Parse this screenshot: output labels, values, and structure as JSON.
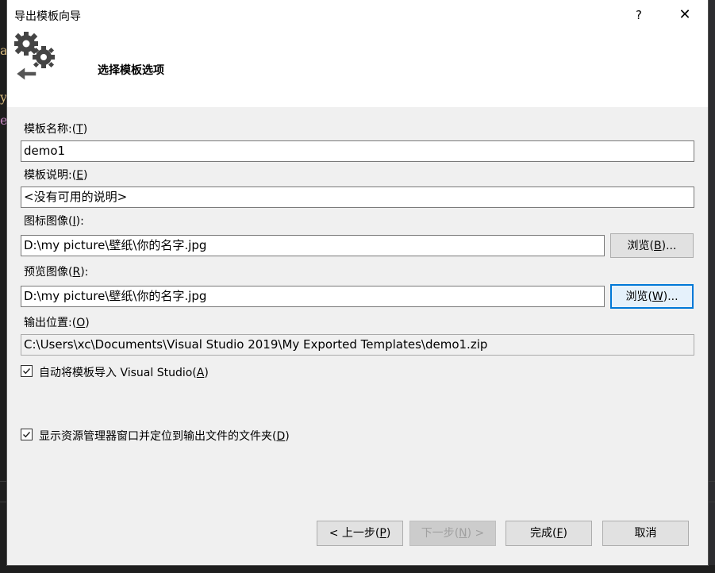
{
  "window": {
    "title": "导出模板向导",
    "help_label": "?",
    "close_label": "✕"
  },
  "header": {
    "title": "选择模板选项",
    "icon": "gear-export-icon"
  },
  "background": {
    "text_lines": [
      "a",
      "y",
      "e"
    ]
  },
  "form": {
    "template_name": {
      "label": "模板名称:",
      "hotkey": "T",
      "value": "demo1"
    },
    "template_desc": {
      "label": "模板说明:",
      "hotkey": "E",
      "value": "<没有可用的说明>"
    },
    "icon_image": {
      "label": "图标图像",
      "hotkey": "I",
      "value": "D:\\my picture\\壁纸\\你的名字.jpg",
      "browse_label": "浏览",
      "browse_hotkey": "B"
    },
    "preview_image": {
      "label": "预览图像",
      "hotkey": "R",
      "value": "D:\\my picture\\壁纸\\你的名字.jpg",
      "browse_label": "浏览",
      "browse_hotkey": "W"
    },
    "output_location": {
      "label": "输出位置:",
      "hotkey": "O",
      "value": "C:\\Users\\xc\\Documents\\Visual Studio 2019\\My Exported Templates\\demo1.zip"
    },
    "auto_import": {
      "label": "自动将模板导入 Visual Studio",
      "hotkey": "A",
      "checked": true
    },
    "show_explorer": {
      "label": "显示资源管理器窗口并定位到输出文件的文件夹",
      "hotkey": "D",
      "checked": true
    }
  },
  "footer": {
    "prev": {
      "label": "< 上一步",
      "hotkey": "P"
    },
    "next": {
      "label": "下一步",
      "hotkey": "N",
      "suffix": " >"
    },
    "finish": {
      "label": "完成",
      "hotkey": "F"
    },
    "cancel": {
      "label": "取消"
    }
  },
  "colors": {
    "accent": "#0078d7",
    "dialog_bg": "#f0f0f0",
    "ide_bg": "#1e1e1e"
  }
}
